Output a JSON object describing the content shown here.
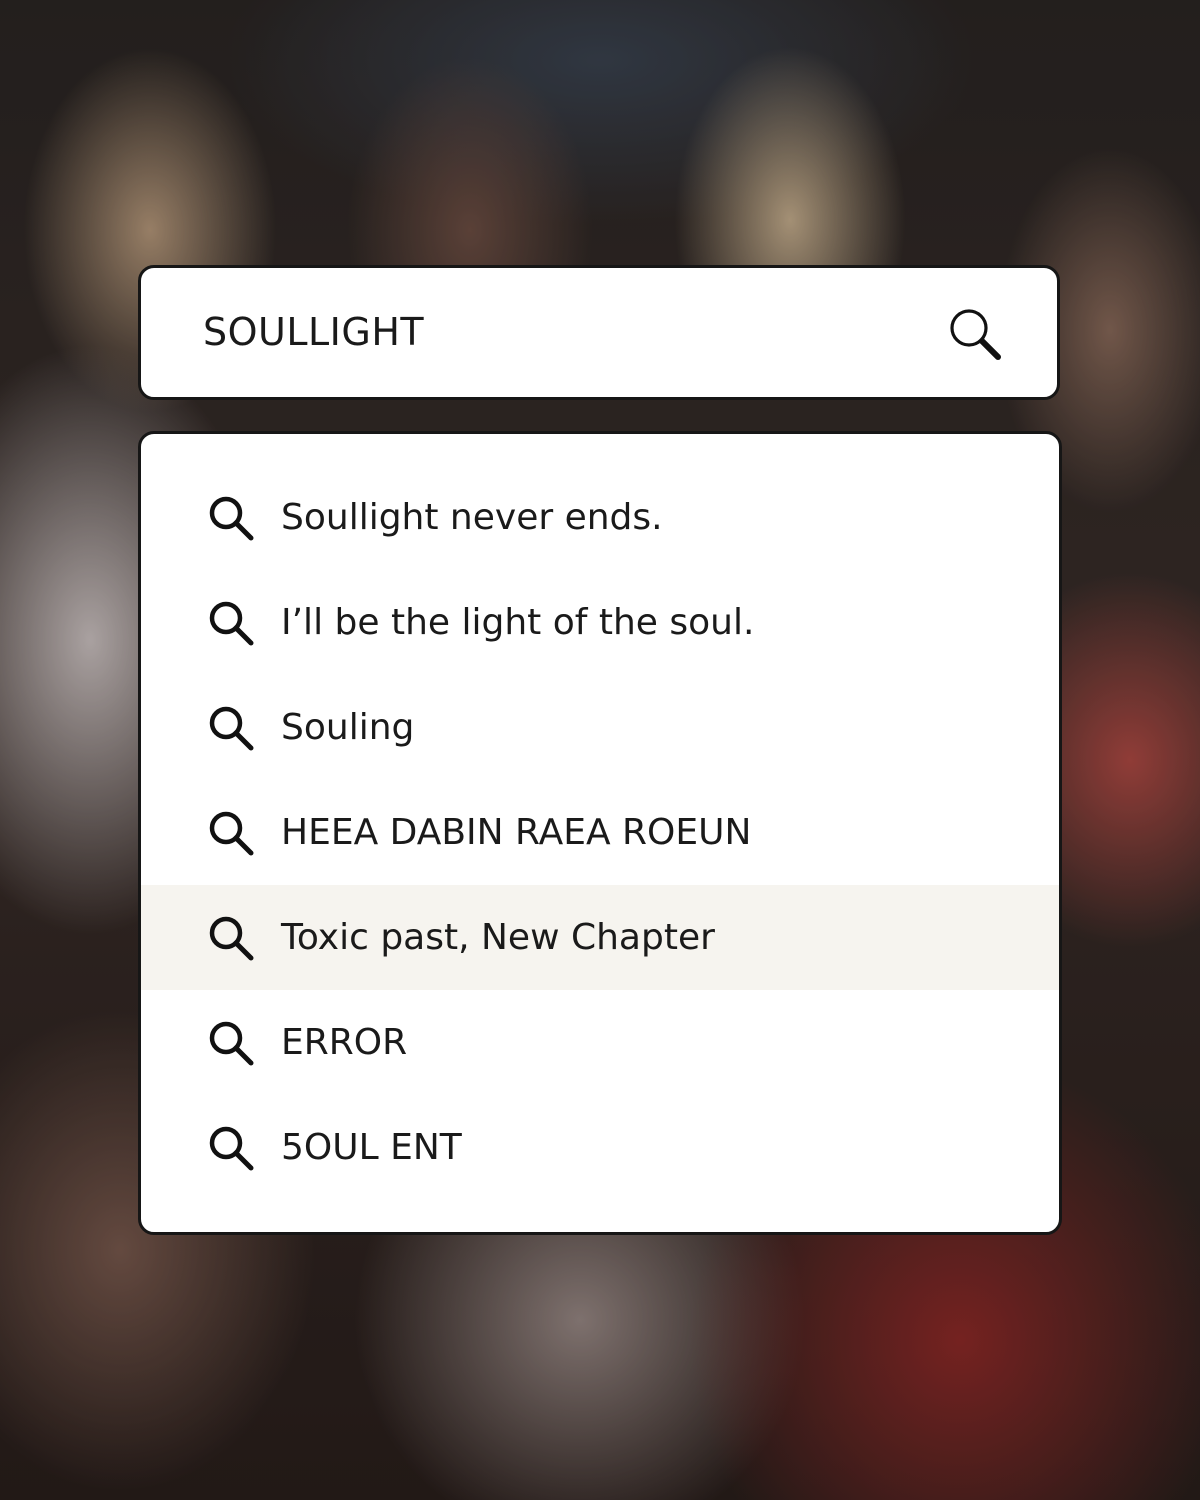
{
  "search": {
    "query": "SOULLIGHT",
    "button_icon": "magnifier-icon"
  },
  "suggestions": [
    {
      "label": "Soullight never ends.",
      "icon": "search-icon",
      "highlighted": false
    },
    {
      "label": "I’ll be the light of the soul.",
      "icon": "search-icon",
      "highlighted": false
    },
    {
      "label": "Souling",
      "icon": "search-icon",
      "highlighted": false
    },
    {
      "label": "HEEA DABIN RAEA ROEUN",
      "icon": "search-icon",
      "highlighted": false
    },
    {
      "label": "Toxic past, New Chapter",
      "icon": "search-icon",
      "highlighted": true
    },
    {
      "label": "ERROR",
      "icon": "search-icon",
      "highlighted": false
    },
    {
      "label": "5OUL ENT",
      "icon": "search-icon",
      "highlighted": false
    }
  ],
  "colors": {
    "panel_background": "#ffffff",
    "panel_border": "#161616",
    "highlight_row": "#f6f4ef",
    "text": "#1a1a1a"
  }
}
